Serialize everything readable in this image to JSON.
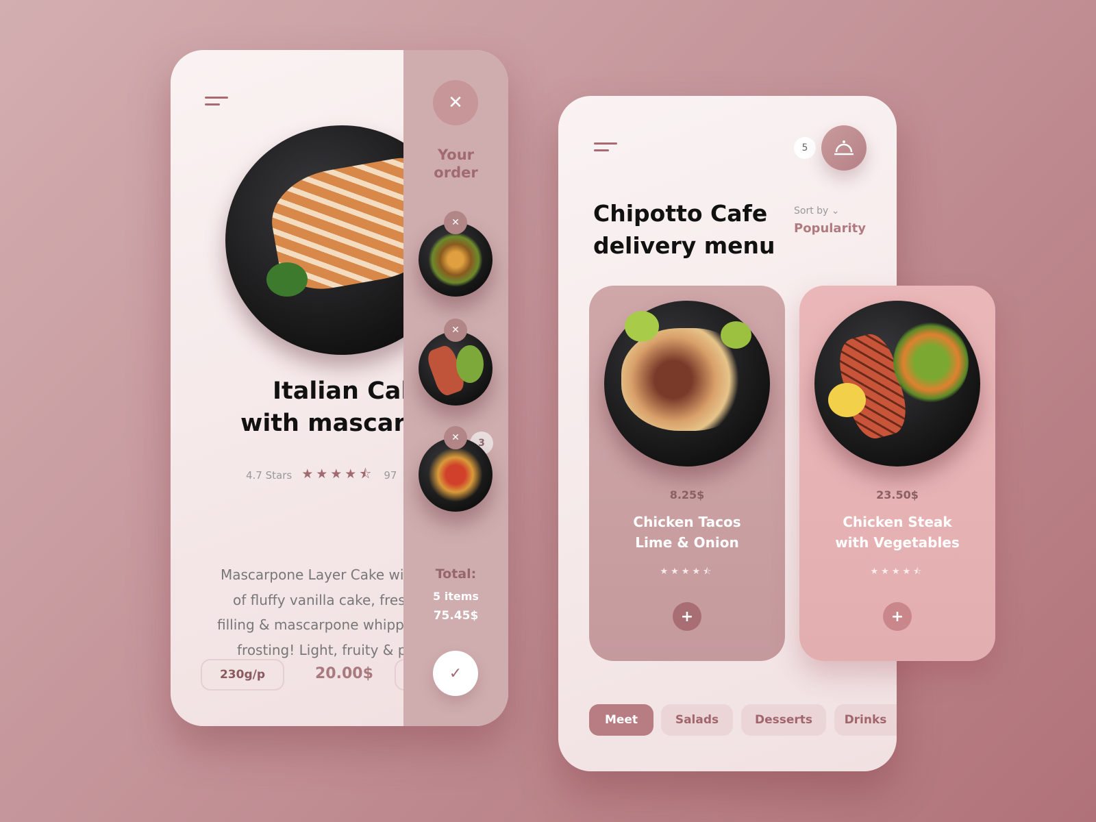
{
  "detail": {
    "title_lines": [
      "Italian Cake",
      "with mascarpo"
    ],
    "rating_text": "4.7 Stars",
    "rating": 4.7,
    "review_count": "97",
    "description_lines": [
      "Mascarpone Layer Cake wit",
      "of fluffy vanilla cake, fresh",
      "filling & mascarpone whippe",
      "frosting! Light, fruity & pe"
    ],
    "weight": "230g/p",
    "price": "20.00$"
  },
  "order": {
    "title_lines": [
      "Your",
      "order"
    ],
    "item_quantity_badge": "3",
    "total_label": "Total:",
    "items": "5 items",
    "amount": "75.45$"
  },
  "menu": {
    "cart_count": "5",
    "title_lines": [
      "Chipotto Cafe",
      "delivery menu"
    ],
    "sort_label": "Sort by",
    "sort_value": "Popularity",
    "items": [
      {
        "price": "8.25$",
        "name_lines": [
          "Chicken Tacos",
          "Lime & Onion"
        ],
        "rating": 4.5
      },
      {
        "price": "23.50$",
        "name_lines": [
          "Chicken Steak",
          "with Vegetables"
        ],
        "rating": 4.5
      }
    ],
    "tabs": [
      {
        "label": "Meet",
        "active": true
      },
      {
        "label": "Salads"
      },
      {
        "label": "Desserts"
      },
      {
        "label": "Drinks"
      }
    ]
  },
  "colors": {
    "accent": "#a86a70",
    "panel": "#cfadae",
    "card_active": "#e8b5b7"
  }
}
